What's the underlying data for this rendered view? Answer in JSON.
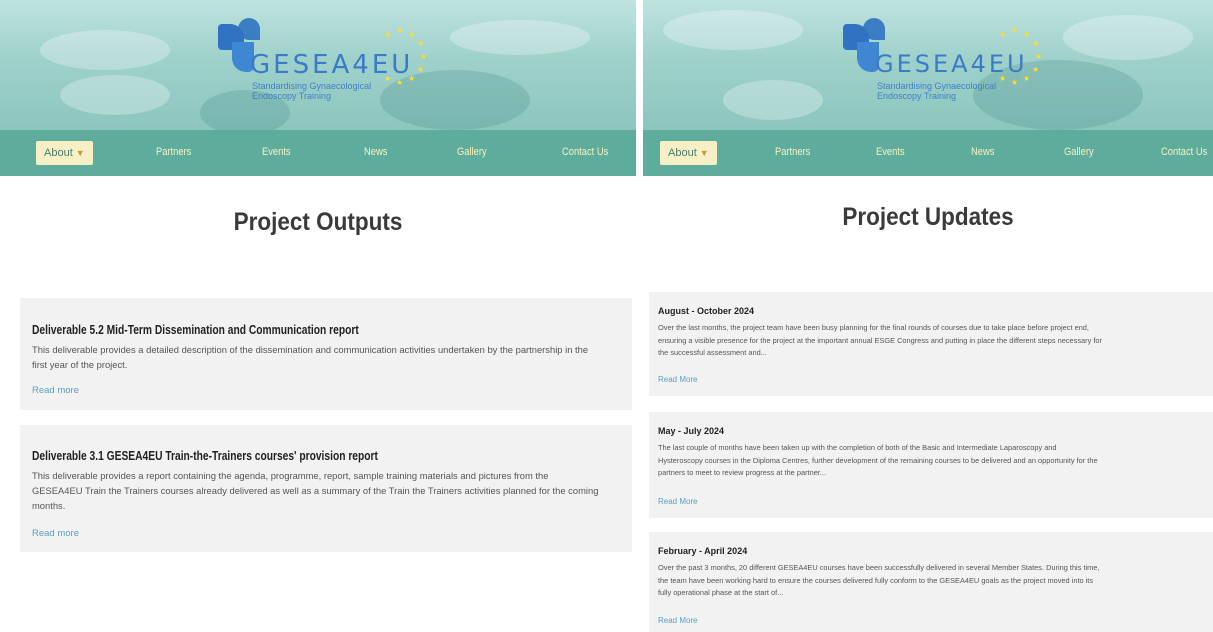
{
  "logo": {
    "name": "GESEA4EU",
    "tagline_line1": "Standardising Gynaecological",
    "tagline_line2": "Endoscopy Training"
  },
  "nav": {
    "items": [
      "About",
      "Partners",
      "Events",
      "News",
      "Gallery",
      "Contact Us"
    ]
  },
  "colors": {
    "nav_bg": "#5eac9c",
    "nav_text": "#f6f2c2",
    "about_bg": "#f6f0c4",
    "card_bg": "#f2f2f2",
    "link": "#5a9fbf",
    "logo_blue": "#3a7bc8",
    "star_yellow": "#ffdd2e"
  },
  "icons": {
    "about_chevron": "chevron-down-icon",
    "eu_stars": "eu-stars-icon"
  },
  "left": {
    "title": "Project Outputs",
    "outputs": [
      {
        "title": "Deliverable 5.2 Mid-Term Dissemination and Communication report",
        "text_lines": [
          "This deliverable provides a detailed description of the dissemination and communication activities undertaken by the partnership in the",
          "first year of the project."
        ],
        "link": "Read more"
      },
      {
        "title": "Deliverable 3.1 GESEA4EU Train-the-Trainers courses' provision report",
        "text_lines": [
          "This deliverable provides a report containing the agenda, programme, report, sample training materials and pictures from the",
          "GESEA4EU Train the Trainers courses already delivered as well as a summary of the Train the Trainers activities planned for the coming",
          "months."
        ],
        "link": "Read more"
      }
    ]
  },
  "right": {
    "title": "Project Updates",
    "updates": [
      {
        "title": "August - October 2024",
        "text_lines": [
          "Over the last months, the project team have been busy planning for the final rounds of courses due to take place before project end,",
          "ensuring a visible presence for the project at the important annual ESGE Congress and putting in place the different steps necessary for",
          "the successful assessment and..."
        ],
        "link": "Read More"
      },
      {
        "title": "May - July 2024",
        "text_lines": [
          "The last couple of months have been taken up with the completion of both of the Basic and Intermediate Laparoscopy and",
          "Hysteroscopy courses in the Diploma Centres, further development of the remaining courses to be delivered and an opportunity for the",
          "partners to meet to review progress at the partner..."
        ],
        "link": "Read More"
      },
      {
        "title": "February - April 2024",
        "text_lines": [
          "Over the past 3 months, 20 different GESEA4EU courses have been successfully delivered in several Member States. During this time,",
          "the team have been working hard to ensure the courses delivered fully conform to the GESEA4EU goals as the project moved into its",
          "fully operational phase at the start of..."
        ],
        "link": "Read More"
      }
    ]
  }
}
